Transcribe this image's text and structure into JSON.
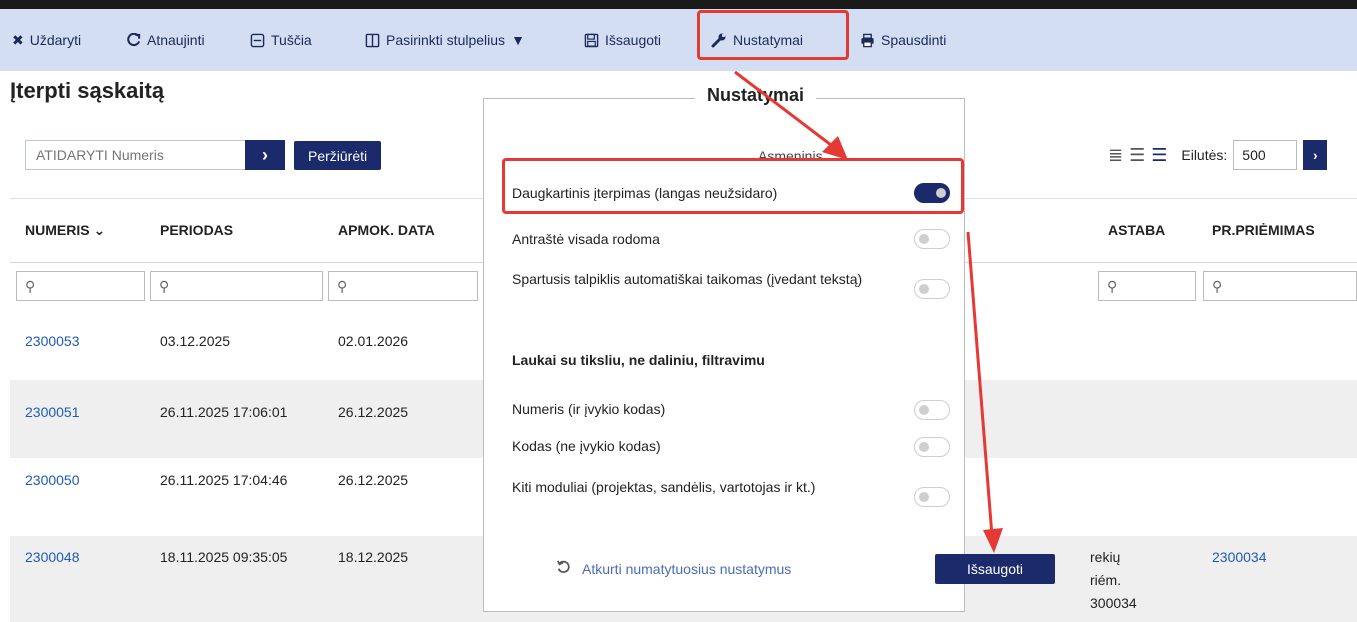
{
  "toolbar": {
    "close": "Uždaryti",
    "refresh": "Atnaujinti",
    "clear": "Tuščia",
    "choose_columns": "Pasirinkti stulpelius",
    "save": "Išsaugoti",
    "settings": "Nustatymai",
    "print": "Spausdinti"
  },
  "page": {
    "title": "Įterpti sąskaitą",
    "search_placeholder": "ATIDARYTI Numeris",
    "view_button": "Peržiūrėti",
    "rows_label": "Eilutės:",
    "rows_value": "500"
  },
  "table": {
    "headers": [
      "NUMERIS",
      "PERIODAS",
      "APMOK. DATA",
      "ASTABA",
      "PR.PRIĖMIMAS"
    ],
    "rows": [
      {
        "numeris": "2300053",
        "periodas": "03.12.2025",
        "apmok": "02.01.2026"
      },
      {
        "numeris": "2300051",
        "periodas": "26.11.2025 17:06:01",
        "apmok": "26.12.2025"
      },
      {
        "numeris": "2300050",
        "periodas": "26.11.2025 17:04:46",
        "apmok": "26.12.2025"
      },
      {
        "numeris": "2300048",
        "periodas": "18.11.2025 09:35:05",
        "apmok": "18.12.2025",
        "pastaba_1": "rekių",
        "pastaba_2": "riém.",
        "pastaba_3": "300034",
        "pr": "2300034"
      }
    ]
  },
  "modal": {
    "title": "Nustatymai",
    "subtitle": "Asmeninis",
    "settings": [
      {
        "label": "Daugkartinis įterpimas (langas neužsidaro)",
        "on": true
      },
      {
        "label": "Antraštė visada rodoma",
        "on": false
      },
      {
        "label": "Spartusis talpiklis automatiškai taikomas (įvedant tekstą)",
        "on": false
      }
    ],
    "section_title": "Laukai su tiksliu, ne daliniu, filtravimu",
    "filters": [
      {
        "label": "Numeris (ir įvykio kodas)",
        "on": false
      },
      {
        "label": "Kodas (ne įvykio kodas)",
        "on": false
      },
      {
        "label": "Kiti moduliai (projektas, sandėlis, vartotojas ir kt.)",
        "on": false
      }
    ],
    "reset": "Atkurti numatytuosius nustatymus",
    "save": "Išsaugoti"
  },
  "colors": {
    "accent": "#1b2a6b",
    "toolbar_bg": "#d3def2",
    "link": "#1e5bb8",
    "highlight": "#e53935"
  }
}
